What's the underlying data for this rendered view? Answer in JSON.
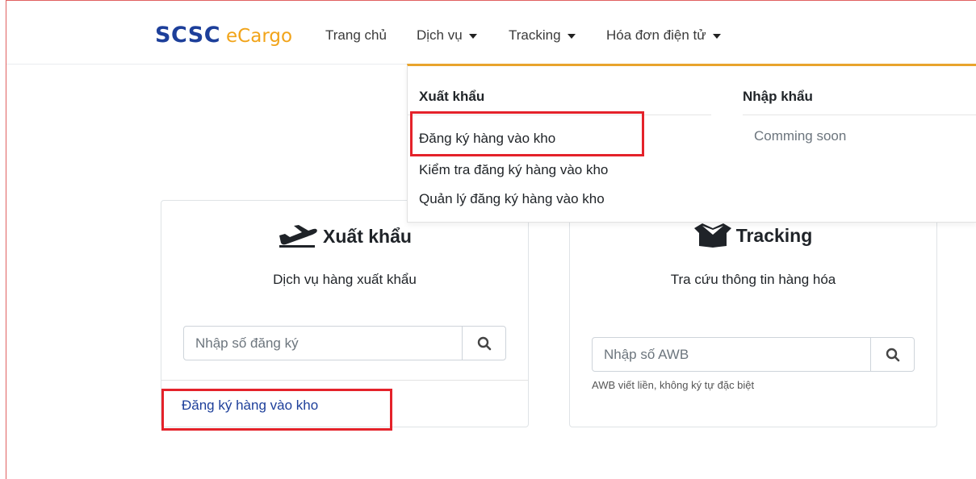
{
  "brand": {
    "scsc": "SCSC",
    "ecargo": "eCargo"
  },
  "nav": {
    "home": "Trang chủ",
    "services": "Dịch vụ",
    "tracking": "Tracking",
    "einvoice": "Hóa đơn điện tử"
  },
  "dropdown": {
    "export_heading": "Xuất khẩu",
    "import_heading": "Nhập khẩu",
    "export_items": [
      "Đăng ký hàng vào kho",
      "Kiểm tra đăng ký hàng vào kho",
      "Quản lý đăng ký hàng vào kho"
    ],
    "import_note": "Comming soon"
  },
  "export_card": {
    "title": "Xuất khẩu",
    "subtitle": "Dịch vụ hàng xuất khẩu",
    "input_placeholder": "Nhập số đăng ký",
    "footer_link": "Đăng ký hàng vào kho"
  },
  "tracking_card": {
    "title": "Tracking",
    "subtitle": "Tra cứu thông tin hàng hóa",
    "input_placeholder": "Nhập số AWB",
    "hint": "AWB viết liền, không ký tự đặc biệt"
  },
  "colors": {
    "brand_blue": "#1d3f9a",
    "brand_orange": "#f1a41a",
    "highlight_red": "#e4222a",
    "dropdown_border": "#e8a42c"
  }
}
